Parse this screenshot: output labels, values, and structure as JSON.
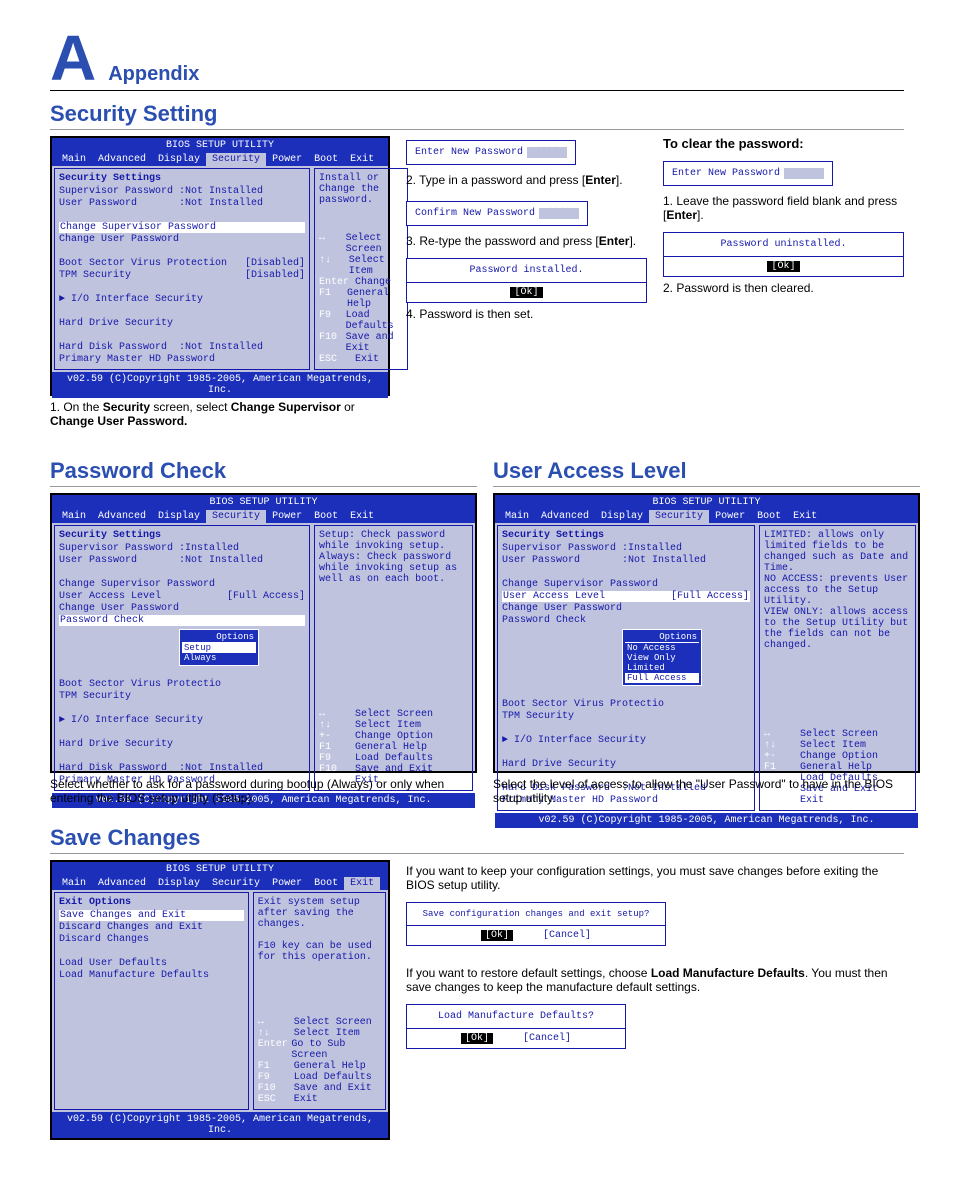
{
  "header": {
    "letter": "A",
    "appendix": "Appendix"
  },
  "sec1": {
    "title": "Security Setting",
    "bios": {
      "title": "BIOS SETUP UTILITY",
      "menu": [
        "Main",
        "Advanced",
        "Display",
        "Security",
        "Power",
        "Boot",
        "Exit"
      ],
      "selected": "Security",
      "heading": "Security Settings",
      "lines": [
        "Supervisor Password :Not Installed",
        "User Password       :Not Installed",
        "",
        "Change Supervisor Password",
        "Change User Password",
        "",
        "Boot Sector Virus Protection   [Disabled]",
        "TPM Security                   [Disabled]",
        "",
        "► I/O Interface Security",
        "",
        "Hard Drive Security",
        "",
        "Hard Disk Password  :Not Installed",
        "Primary Master HD Password"
      ],
      "hlIndex": 3,
      "rightTop": "Install or Change the password.",
      "keys": [
        [
          "↔",
          "Select Screen"
        ],
        [
          "↑↓",
          "Select Item"
        ],
        [
          "Enter",
          "Change"
        ],
        [
          "F1",
          "General Help"
        ],
        [
          "F9",
          "Load Defaults"
        ],
        [
          "F10",
          "Save and Exit"
        ],
        [
          "ESC",
          "Exit"
        ]
      ],
      "footer": "v02.59 (C)Copyright 1985-2005, American Megatrends, Inc."
    },
    "step1": "1. On the Security screen, select Change Supervisor or Change User Password.",
    "enterNew": "Enter New Password",
    "step2": "2. Type in a password and press [Enter].",
    "confirmNew": "Confirm New Password",
    "step3": "3. Re-type the password and press [Enter].",
    "installed": "Password installed.",
    "ok": "[Ok]",
    "step4": "4. Password is then set.",
    "clearHead": "To clear the password:",
    "clearEnter": "Enter New Password",
    "clear1": "1. Leave the password field blank and press [Enter].",
    "uninstalled": "Password uninstalled.",
    "clear2": "2. Password is then cleared."
  },
  "sec2": {
    "title": "Password Check",
    "bios": {
      "title": "BIOS SETUP UTILITY",
      "menu": [
        "Main",
        "Advanced",
        "Display",
        "Security",
        "Power",
        "Boot",
        "Exit"
      ],
      "selected": "Security",
      "heading": "Security Settings",
      "lines": [
        "Supervisor Password :Installed",
        "User Password       :Not Installed",
        "",
        "Change Supervisor Password",
        "User Access Level           [Full Access]",
        "Change User Password",
        "Password Check",
        "",
        "Boot Sector Virus Protectio",
        "TPM Security",
        "",
        "► I/O Interface Security",
        "",
        "Hard Drive Security",
        "",
        "Hard Disk Password  :Not Installed",
        "Primary Master HD Password"
      ],
      "hlIndex": 6,
      "popup": {
        "title": "Options",
        "opts": [
          "Setup",
          "Always"
        ],
        "selIndex": 0,
        "afterLine": 6
      },
      "rightTop": "Setup: Check password while invoking setup.\nAlways: Check password while invoking setup as well as on each boot.",
      "keys": [
        [
          "↔",
          "Select Screen"
        ],
        [
          "↑↓",
          "Select Item"
        ],
        [
          "+-",
          "Change Option"
        ],
        [
          "F1",
          "General Help"
        ],
        [
          "F9",
          "Load Defaults"
        ],
        [
          "F10",
          "Save and Exit"
        ],
        [
          "ESC",
          "Exit"
        ]
      ],
      "footer": "v02.59 (C)Copyright 1985-2005, American Megatrends, Inc."
    },
    "caption": "Select whether to ask for a password during bootup (Always) or only when entering the BIOS setup utility (Setup)."
  },
  "sec3": {
    "title": "User Access Level",
    "bios": {
      "title": "BIOS SETUP UTILITY",
      "menu": [
        "Main",
        "Advanced",
        "Display",
        "Security",
        "Power",
        "Boot",
        "Exit"
      ],
      "selected": "Security",
      "heading": "Security Settings",
      "lines": [
        "Supervisor Password :Installed",
        "User Password       :Not Installed",
        "",
        "Change Supervisor Password",
        "User Access Level           [Full Access]",
        "Change User Password",
        "Password Check",
        "",
        "Boot Sector Virus Protectio",
        "TPM Security",
        "",
        "► I/O Interface Security",
        "",
        "Hard Drive Security",
        "",
        "Hard Disk Password  :Not Installed",
        "Primary Master HD Password"
      ],
      "hlIndex": 4,
      "popup": {
        "title": "Options",
        "opts": [
          "No Access",
          "View Only",
          "Limited",
          "Full Access"
        ],
        "selIndex": 3,
        "afterLine": 6
      },
      "rightTop": "LIMITED: allows only limited fields to be changed such as Date and Time.\nNO ACCESS: prevents User access to the Setup Utility.\nVIEW ONLY: allows access to the Setup Utility but the fields can not be changed.",
      "keys": [
        [
          "↔",
          "Select Screen"
        ],
        [
          "↑↓",
          "Select Item"
        ],
        [
          "+-",
          "Change Option"
        ],
        [
          "F1",
          "General Help"
        ],
        [
          "F9",
          "Load Defaults"
        ],
        [
          "F10",
          "Save and Exit"
        ],
        [
          "ESC",
          "Exit"
        ]
      ],
      "footer": "v02.59 (C)Copyright 1985-2005, American Megatrends, Inc."
    },
    "caption": "Select the level of access to allow the \"User Password\" to have in the BIOS setup utility."
  },
  "sec4": {
    "title": "Save Changes",
    "bios": {
      "title": "BIOS SETUP UTILITY",
      "menu": [
        "Main",
        "Advanced",
        "Display",
        "Security",
        "Power",
        "Boot",
        "Exit"
      ],
      "selected": "Exit",
      "heading": "Exit Options",
      "lines": [
        "Save Changes and Exit",
        "Discard Changes and Exit",
        "Discard Changes",
        "",
        "Load User Defaults",
        "Load Manufacture Defaults"
      ],
      "hlIndex": 0,
      "rightTop": "Exit system setup after saving the changes.\n\nF10 key can be used for this operation.",
      "keys": [
        [
          "↔",
          "Select Screen"
        ],
        [
          "↑↓",
          "Select Item"
        ],
        [
          "Enter",
          "Go to Sub Screen"
        ],
        [
          "F1",
          "General Help"
        ],
        [
          "F9",
          "Load Defaults"
        ],
        [
          "F10",
          "Save and Exit"
        ],
        [
          "ESC",
          "Exit"
        ]
      ],
      "footer": "v02.59 (C)Copyright 1985-2005, American Megatrends, Inc."
    },
    "text1": "If you want to keep your configuration settings, you must save changes before exiting the BIOS setup utility.",
    "dlg1": {
      "q": "Save configuration changes and exit setup?",
      "ok": "[Ok]",
      "cancel": "[Cancel]"
    },
    "text2a": "If you want to restore default settings, choose ",
    "text2b": "Load Manufacture Defaults",
    "text2c": ". You must then save changes to keep the manufacture default settings.",
    "dlg2": {
      "q": "Load Manufacture Defaults?",
      "ok": "[Ok]",
      "cancel": "[Cancel]"
    }
  }
}
